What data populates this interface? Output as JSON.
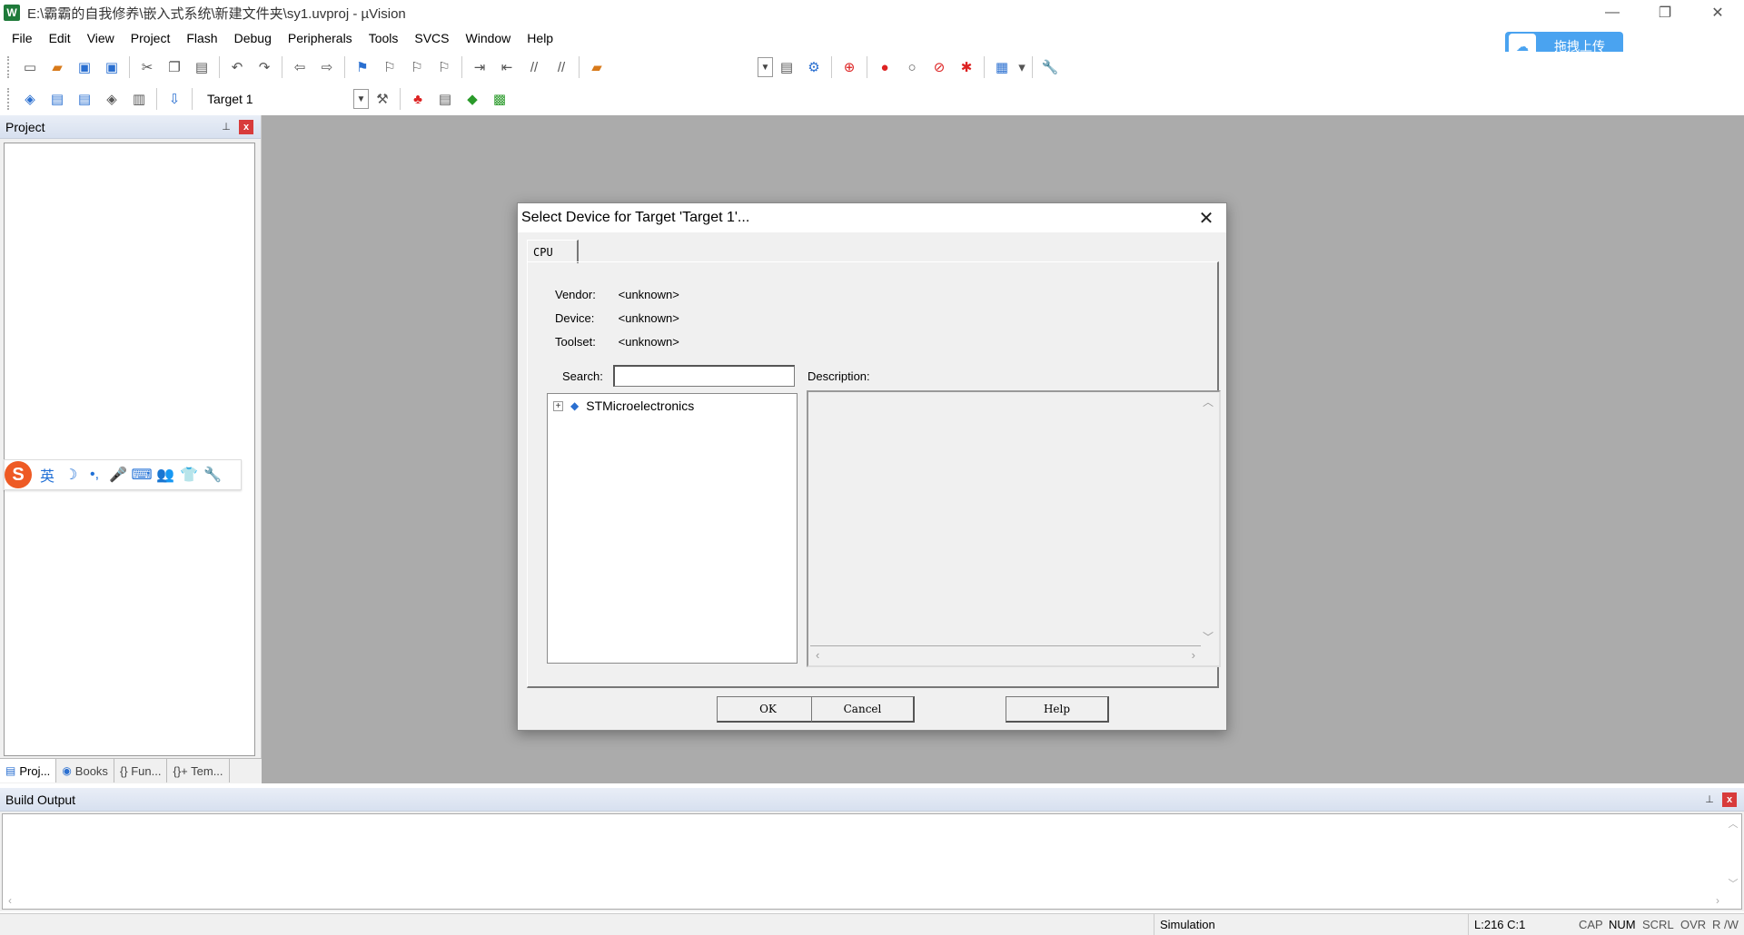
{
  "window": {
    "title": "E:\\霸霸的自我修养\\嵌入式系统\\新建文件夹\\sy1.uvproj - µVision",
    "app_icon": "W",
    "minimize": "—",
    "restore": "❐",
    "close": "✕"
  },
  "menu": [
    "File",
    "Edit",
    "View",
    "Project",
    "Flash",
    "Debug",
    "Peripherals",
    "Tools",
    "SVCS",
    "Window",
    "Help"
  ],
  "upload_button": {
    "label": "拖拽上传",
    "icon": "cloud-icon"
  },
  "toolbar2": {
    "target_value": "Target 1"
  },
  "project_panel": {
    "title": "Project",
    "pin": "⊥",
    "close": "x",
    "tabs": [
      {
        "label": "Proj...",
        "icon": "project-icon"
      },
      {
        "label": "Books",
        "icon": "books-icon"
      },
      {
        "label": "{} Fun...",
        "icon": "functions-icon"
      },
      {
        "label": "{}+ Tem...",
        "icon": "templates-icon"
      }
    ]
  },
  "ime_bar": {
    "logo": "S",
    "lang": "英",
    "moon": "☽",
    "punct": "•,",
    "mic": "🎤",
    "keyboard": "⌨",
    "user": "👥",
    "shirt": "👕",
    "wrench": "🔧"
  },
  "dialog": {
    "title": "Select Device for Target 'Target 1'...",
    "close": "✕",
    "tab": "CPU",
    "vendor_key": "Vendor:",
    "vendor_val": "<unknown>",
    "device_key": "Device:",
    "device_val": "<unknown>",
    "toolset_key": "Toolset:",
    "toolset_val": "<unknown>",
    "search_label": "Search:",
    "search_value": "",
    "description_label": "Description:",
    "tree_node": "STMicroelectronics",
    "tree_expander": "+",
    "buttons": {
      "ok": "OK",
      "cancel": "Cancel",
      "help": "Help"
    }
  },
  "build_output": {
    "title": "Build Output",
    "pin": "⊥",
    "close": "x"
  },
  "status": {
    "mode": "Simulation",
    "position": "L:216 C:1",
    "cap": "CAP",
    "num": "NUM",
    "scrl": "SCRL",
    "ovr": "OVR",
    "rw": "R /W"
  }
}
